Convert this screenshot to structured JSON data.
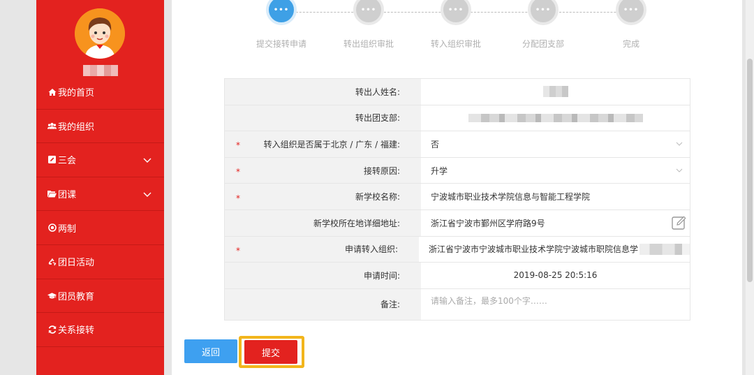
{
  "sidebar": {
    "username_masked": "",
    "items": [
      {
        "icon": "home-icon",
        "label": "我的首页",
        "expandable": false
      },
      {
        "icon": "users-icon",
        "label": "我的组织",
        "expandable": false
      },
      {
        "icon": "edit-icon",
        "label": "三会",
        "expandable": true
      },
      {
        "icon": "folder-open-icon",
        "label": "团课",
        "expandable": true
      },
      {
        "icon": "dot-circle-icon",
        "label": "两制",
        "expandable": false
      },
      {
        "icon": "recycle-icon",
        "label": "团日活动",
        "expandable": false
      },
      {
        "icon": "graduation-cap-icon",
        "label": "团员教育",
        "expandable": false
      },
      {
        "icon": "refresh-icon",
        "label": "关系接转",
        "expandable": false
      }
    ]
  },
  "steps": {
    "dot_text": "•••",
    "items": [
      {
        "label": "提交接转申请",
        "state": "active"
      },
      {
        "label": "转出组织审批",
        "state": "inactive"
      },
      {
        "label": "转入组织审批",
        "state": "inactive"
      },
      {
        "label": "分配团支部",
        "state": "inactive"
      },
      {
        "label": "完成",
        "state": "inactive"
      }
    ]
  },
  "form": {
    "out_name": {
      "label": "转出人姓名:",
      "value": ""
    },
    "out_branch": {
      "label": "转出团支部:",
      "value": ""
    },
    "in_beijing": {
      "label": "转入组织是否属于北京 / 广东 / 福建:",
      "value": "否",
      "required": true
    },
    "reason": {
      "label": "接转原因:",
      "value": "升学",
      "required": true
    },
    "school_name": {
      "label": "新学校名称:",
      "value": "宁波城市职业技术学院信息与智能工程学院",
      "required": true
    },
    "school_address": {
      "label": "新学校所在地详细地址:",
      "value": "浙江省宁波市鄞州区学府路9号"
    },
    "target_org": {
      "label": "申请转入组织:",
      "value": "浙江省宁波市宁波城市职业技术学院宁波城市职院信息学院",
      "required": true
    },
    "apply_time": {
      "label": "申请时间:",
      "value": "2019-08-25 20:5:16"
    },
    "remark": {
      "label": "备注:",
      "placeholder": "请输入备注，最多100个字……"
    }
  },
  "required_mark": "*",
  "buttons": {
    "back": "返回",
    "submit": "提交"
  },
  "colors": {
    "brand_red": "#e3221f",
    "active_blue": "#3ea0e6",
    "highlight": "#f2b51c"
  }
}
